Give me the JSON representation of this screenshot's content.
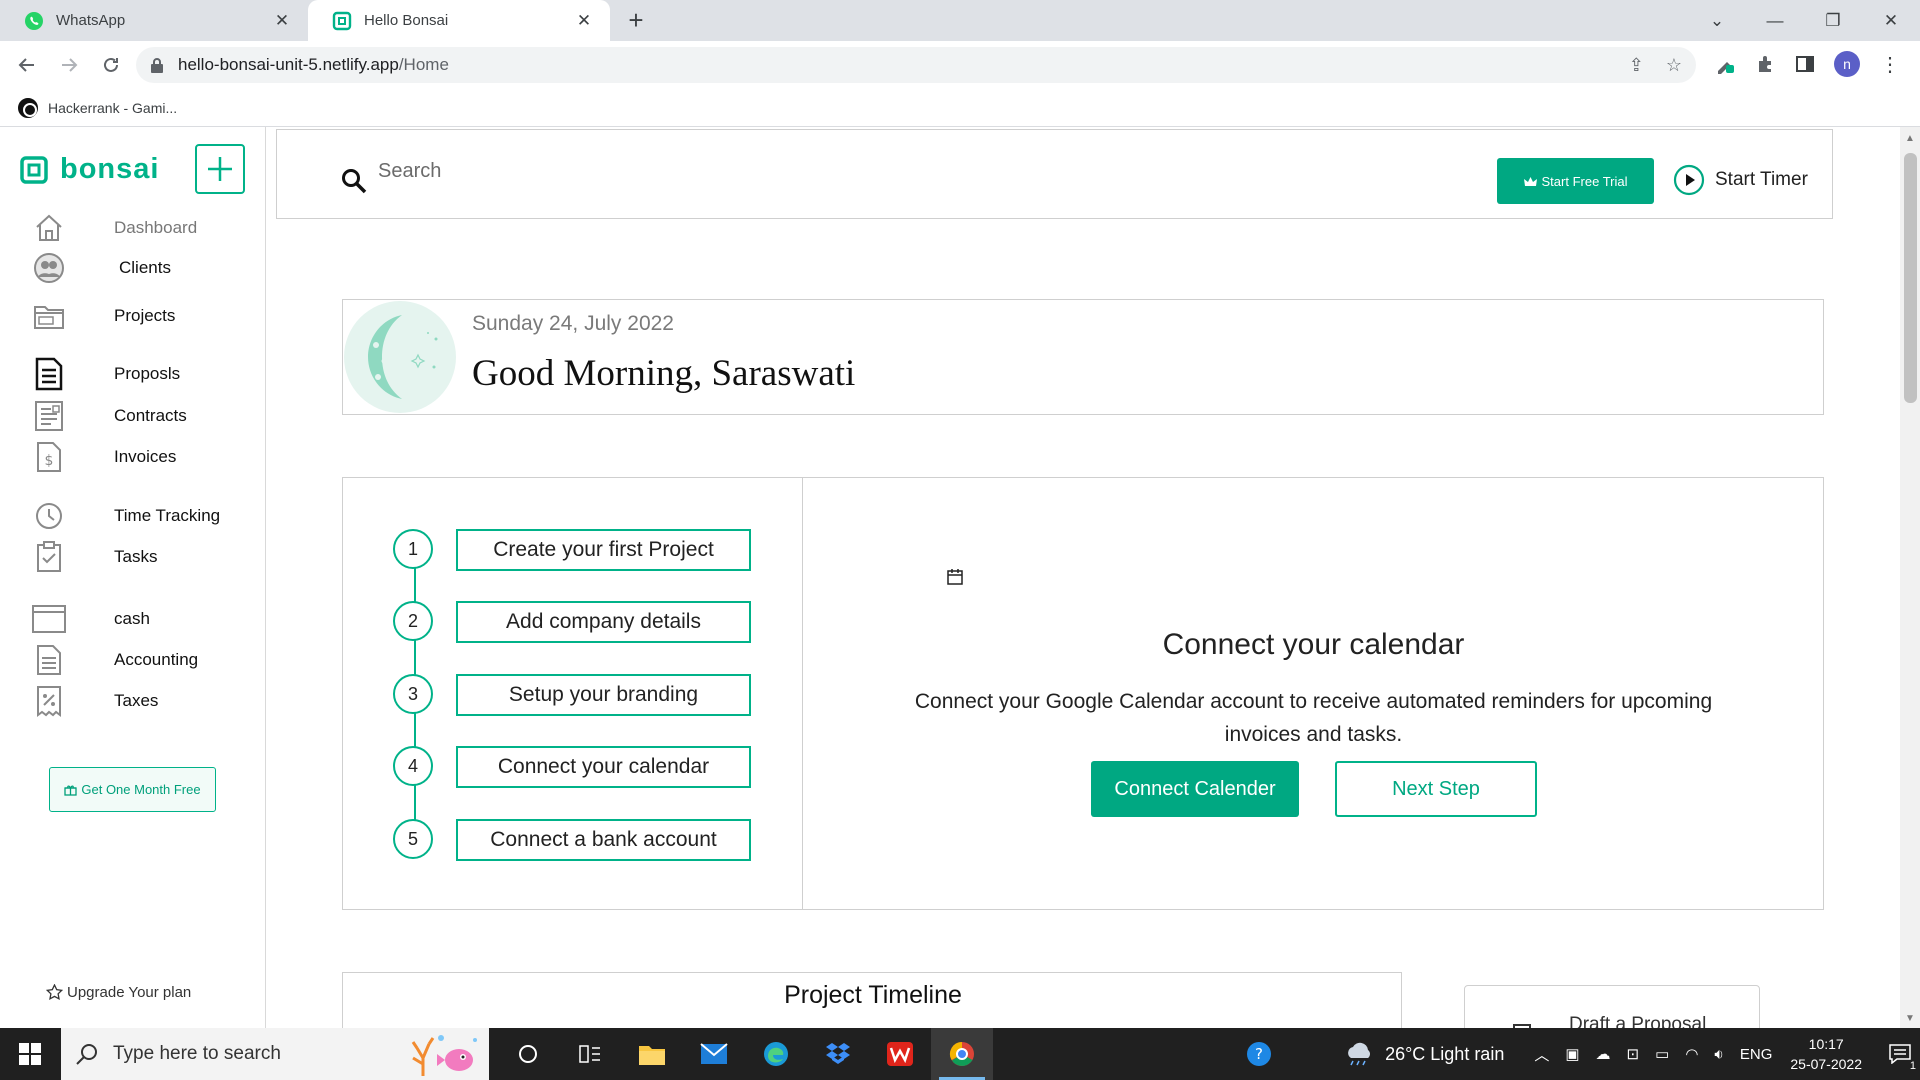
{
  "browser": {
    "tabs": [
      {
        "title": "WhatsApp",
        "active": false
      },
      {
        "title": "Hello Bonsai",
        "active": true
      }
    ],
    "url_host": "hello-bonsai-unit-5.netlify.app",
    "url_path": "/Home",
    "avatar_letter": "n",
    "bookmark": "Hackerrank - Gami..."
  },
  "app": {
    "logo": "bonsai",
    "accent_color": "#00b289",
    "sidebar": {
      "items": [
        {
          "label": "Dashboard",
          "icon": "home-icon"
        },
        {
          "label": "Clients",
          "icon": "clients-icon"
        },
        {
          "label": "Projects",
          "icon": "folder-icon"
        },
        {
          "label": "Proposls",
          "icon": "document-icon"
        },
        {
          "label": "Contracts",
          "icon": "contract-icon"
        },
        {
          "label": "Invoices",
          "icon": "invoice-icon"
        },
        {
          "label": "Time Tracking",
          "icon": "clock-icon"
        },
        {
          "label": "Tasks",
          "icon": "clipboard-check-icon"
        },
        {
          "label": "cash",
          "icon": "wallet-icon"
        },
        {
          "label": "Accounting",
          "icon": "ledger-icon"
        },
        {
          "label": "Taxes",
          "icon": "tax-receipt-icon"
        }
      ],
      "promo": "Get One Month Free",
      "upgrade": "Upgrade Your plan"
    },
    "header": {
      "search_placeholder": "Search",
      "trial_button": "Start Free Trial",
      "timer_button": "Start Timer"
    },
    "greeting": {
      "date": "Sunday 24, July 2022",
      "message": "Good Morning, Saraswati"
    },
    "onboarding": {
      "steps": [
        {
          "num": "1",
          "label": "Create your first Project"
        },
        {
          "num": "2",
          "label": "Add company details"
        },
        {
          "num": "3",
          "label": "Setup your branding"
        },
        {
          "num": "4",
          "label": "Connect your calendar"
        },
        {
          "num": "5",
          "label": "Connect a bank account"
        }
      ],
      "panel_title": "Connect your calendar",
      "panel_desc": "Connect your Google Calendar account to receive automated reminders for upcoming invoices and tasks.",
      "primary_button": "Connect Calender",
      "secondary_button": "Next Step"
    },
    "timeline_title": "Project Timeline",
    "draft_label": "Draft a Proposal"
  },
  "taskbar": {
    "search_placeholder": "Type here to search",
    "weather": "26°C  Light rain",
    "language": "ENG",
    "time": "10:17",
    "date": "25-07-2022",
    "notification_count": "1"
  }
}
